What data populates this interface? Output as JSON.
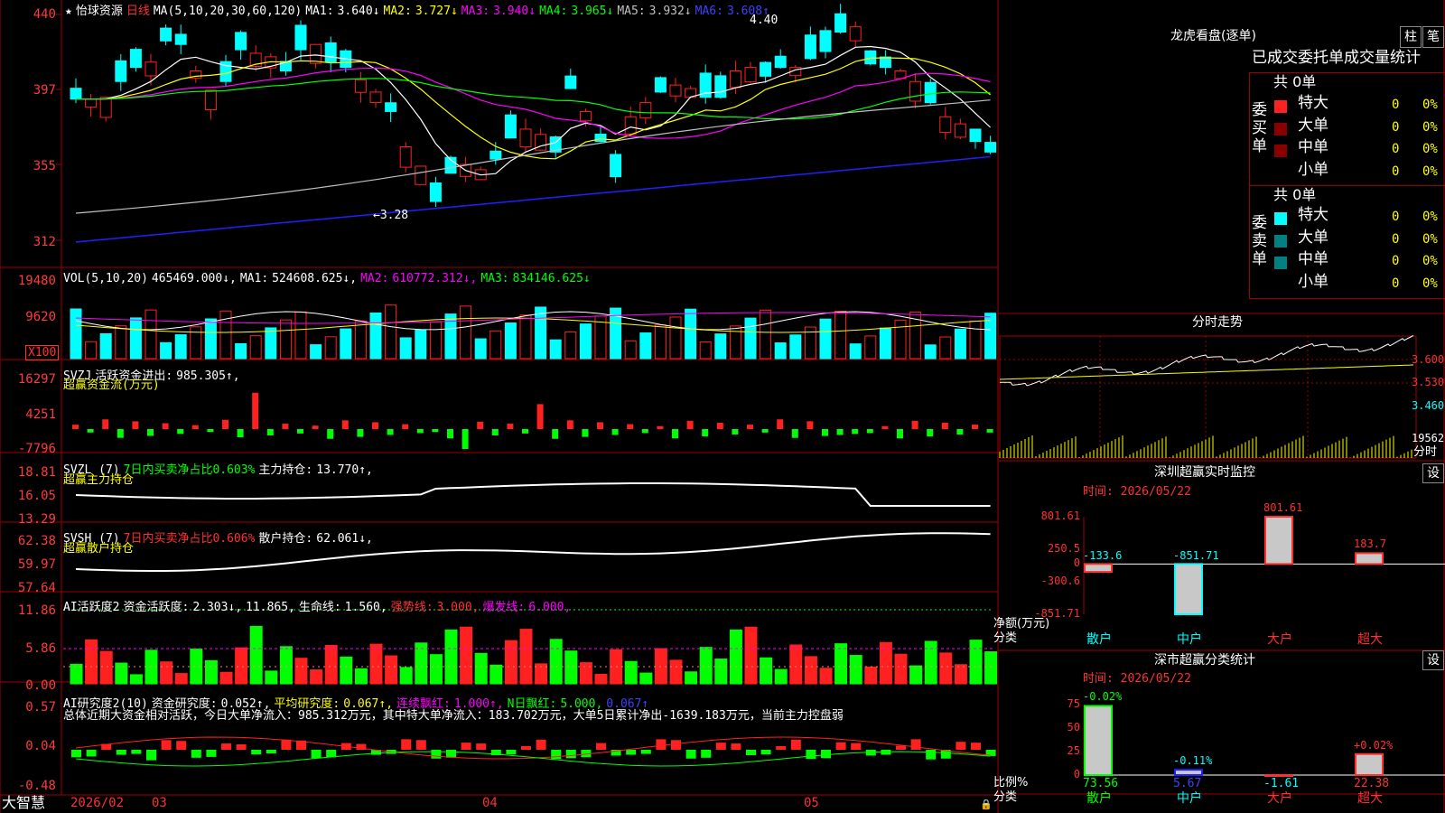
{
  "colors": {
    "up": "#ff2020",
    "down": "#00ffff",
    "bg": "#000000",
    "grid": "#a00000",
    "ma1": "#ffffff",
    "ma2": "#ffff00",
    "ma3": "#ff00ff",
    "ma4": "#00ff00",
    "ma5": "#c0c0c0",
    "ma6": "#2020ff"
  },
  "main": {
    "star": "★",
    "stock_name": "怡球资源",
    "period": "日线",
    "ma_params": "MA(5,10,20,30,60,120)",
    "ma": [
      {
        "label": "MA1:",
        "value": "3.640↓"
      },
      {
        "label": "MA2:",
        "value": "3.727↓"
      },
      {
        "label": "MA3:",
        "value": "3.940↓"
      },
      {
        "label": "MA4:",
        "value": "3.965↓"
      },
      {
        "label": "MA5:",
        "value": "3.932↓"
      },
      {
        "label": "MA6:",
        "value": "3.608↑"
      }
    ],
    "y_ticks": [
      "440",
      "397",
      "355",
      "312"
    ],
    "high_marker": "4.40",
    "low_marker": "←3.28"
  },
  "vol": {
    "title": "VOL(5,10,20)",
    "value": "465469.000↓,",
    "ma": [
      {
        "label": "MA1:",
        "value": "524608.625↓,"
      },
      {
        "label": "MA2:",
        "value": "610772.312↓,"
      },
      {
        "label": "MA3:",
        "value": "834146.625↓"
      }
    ],
    "y_ticks": [
      "19480",
      "9620"
    ],
    "unit": "X100"
  },
  "svzj": {
    "title": "SVZJ",
    "label": "活跃资金进出:",
    "value": "985.305↑,",
    "subtitle": "超赢资金流(万元)",
    "y_ticks": [
      "16297",
      "4251",
      "-7796"
    ]
  },
  "svzl": {
    "title": "SVZL (7)",
    "seven_day": "7日内买卖净占比0.603%",
    "label": "主力持仓:",
    "value": "13.770↑,",
    "subtitle": "超赢主力持仓",
    "y_ticks": [
      "18.81",
      "16.05",
      "13.29"
    ]
  },
  "svsh": {
    "title": "SVSH (7)",
    "seven_day": "7日内买卖净占比0.606%",
    "label": "散户持仓:",
    "value": "62.061↓,",
    "subtitle": "超赢散户持仓",
    "y_ticks": [
      "62.38",
      "59.97",
      "57.64"
    ]
  },
  "ai1": {
    "title": "AI活跃度2",
    "items": [
      {
        "label": "资金活跃度:",
        "value": "2.303↓,"
      },
      {
        "label": "",
        "value": "11.865,"
      },
      {
        "label": "生命线:",
        "value": "1.560,"
      },
      {
        "label": "强势线:",
        "value": "3.000,"
      },
      {
        "label": "爆发线:",
        "value": "6.000,"
      }
    ],
    "y_ticks": [
      "11.86",
      "5.86",
      "0.00"
    ]
  },
  "ai2": {
    "title": "AI研究度2(10)",
    "items": [
      {
        "label": "资金研究度:",
        "value": "0.052↑,"
      },
      {
        "label": "平均研究度:",
        "value": "0.067↑,"
      },
      {
        "label": "连续飘红:",
        "value": "1.000↑,"
      },
      {
        "label": "N日飘红:",
        "value": "5.000,"
      },
      {
        "label": "",
        "value": "0.067↑"
      }
    ],
    "summary": "总体近期大资金相对活跃，今日大单净流入：985.312万元，其中特大单净流入：183.702万元，大单5日累计净出-1639.183万元，当前主力控盘弱",
    "y_ticks": [
      "0.57",
      "0.04",
      "-0.48"
    ]
  },
  "bottom": {
    "brand": "大智慧",
    "dates": [
      "2026/02",
      "03",
      "04",
      "05"
    ]
  },
  "right": {
    "longhu_title": "龙虎看盘(逐单)",
    "btn_bar": "柱",
    "btn_pen": "笔",
    "tabs": "已成交委托单成交量统计",
    "buy": {
      "side": "委买单",
      "total": "共 0单",
      "rows": [
        {
          "name": "特大",
          "count": "0",
          "pct": "0%"
        },
        {
          "name": "大单",
          "count": "0",
          "pct": "0%"
        },
        {
          "name": "中单",
          "count": "0",
          "pct": "0%"
        },
        {
          "name": "小单",
          "count": "0",
          "pct": "0%"
        }
      ]
    },
    "sell": {
      "side": "委卖单",
      "total": "共 0单",
      "rows": [
        {
          "name": "特大",
          "count": "0",
          "pct": "0%"
        },
        {
          "name": "大单",
          "count": "0",
          "pct": "0%"
        },
        {
          "name": "中单",
          "count": "0",
          "pct": "0%"
        },
        {
          "name": "小单",
          "count": "0",
          "pct": "0%"
        }
      ]
    },
    "fenshi": {
      "title": "分时走势",
      "prices": [
        "3.600",
        "3.530",
        "3.460"
      ],
      "vol": "19562",
      "unit": "分时"
    },
    "sz_monitor": {
      "title": "深圳超赢实时监控",
      "settings": "设",
      "time": "时间: 2026/05/22",
      "y_label": "净额(万元)",
      "x_label": "分类",
      "y_ticks": [
        "801.61",
        "250.5",
        "0",
        "-300.6",
        "-851.71"
      ],
      "categories": [
        "散户",
        "中户",
        "大户",
        "超大"
      ],
      "values": [
        "-133.6",
        "-851.71",
        "801.61",
        "183.7"
      ]
    },
    "sz_class": {
      "title": "深市超赢分类统计",
      "settings": "设",
      "time": "时间: 2026/05/22",
      "y_label": "比例%",
      "x_label": "分类",
      "y_ticks": [
        "75",
        "50",
        "25",
        "0"
      ],
      "categories": [
        "散户",
        "中户",
        "大户",
        "超大"
      ],
      "pct_top": [
        "-0.02%",
        "-0.11%",
        "",
        "+0.02%"
      ],
      "values": [
        "73.56",
        "5.67",
        "-1.61",
        "22.38"
      ]
    }
  },
  "chart_data": [
    {
      "type": "bar",
      "title": "深圳超赢实时监控",
      "ylabel": "净额(万元)",
      "xlabel": "分类",
      "categories": [
        "散户",
        "中户",
        "大户",
        "超大"
      ],
      "values": [
        -133.6,
        -851.71,
        801.61,
        183.7
      ],
      "ylim": [
        -851.71,
        801.61
      ]
    },
    {
      "type": "bar",
      "title": "深市超赢分类统计",
      "ylabel": "比例%",
      "xlabel": "分类",
      "categories": [
        "散户",
        "中户",
        "大户",
        "超大"
      ],
      "values": [
        73.56,
        5.67,
        -1.61,
        22.38
      ],
      "ylim": [
        0,
        75
      ]
    }
  ]
}
